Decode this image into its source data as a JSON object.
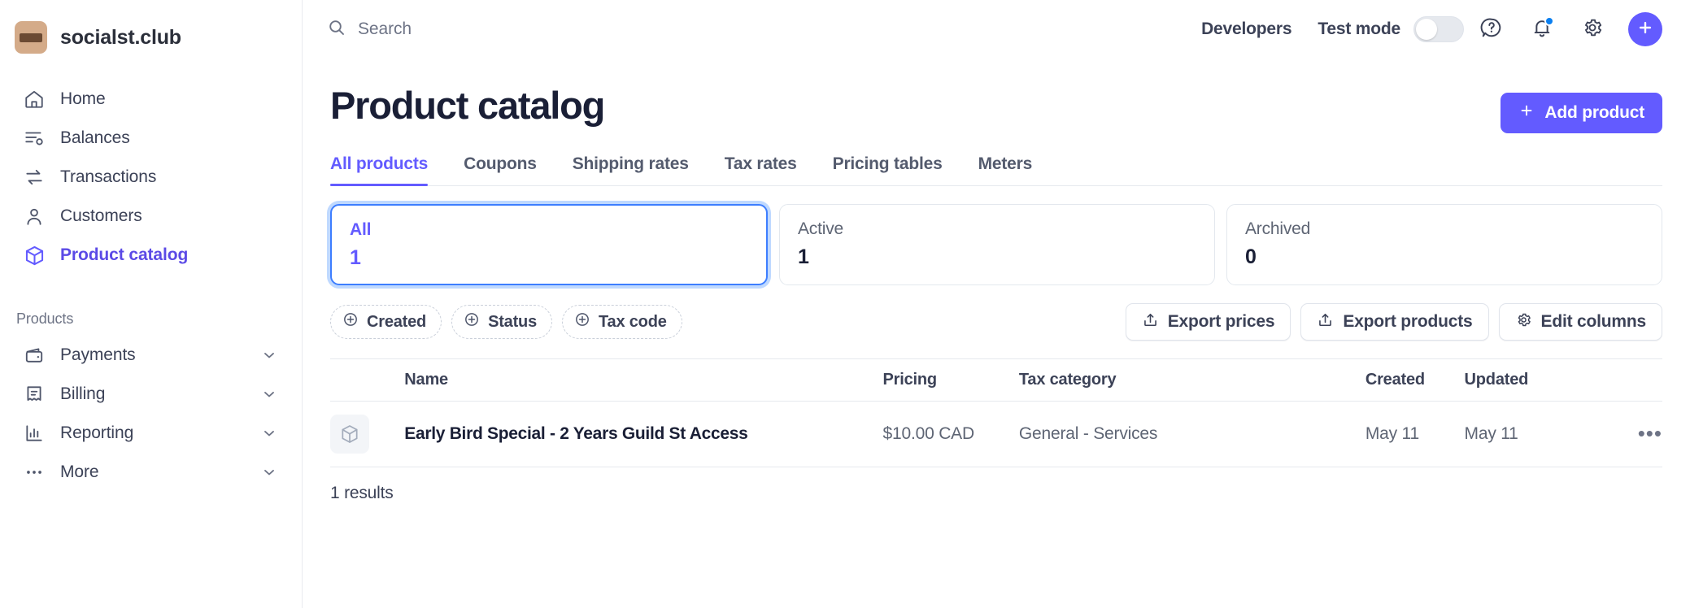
{
  "brand": {
    "name": "socialst.club",
    "avatar_color": "#d4ab89",
    "avatar_bar_color": "#6b4a33"
  },
  "sidebar": {
    "primary_items": [
      {
        "label": "Home",
        "icon": "home-icon",
        "active": false
      },
      {
        "label": "Balances",
        "icon": "balances-icon",
        "active": false
      },
      {
        "label": "Transactions",
        "icon": "transactions-icon",
        "active": false
      },
      {
        "label": "Customers",
        "icon": "customers-icon",
        "active": false
      },
      {
        "label": "Product catalog",
        "icon": "product-catalog-icon",
        "active": true
      }
    ],
    "section_title": "Products",
    "secondary_items": [
      {
        "label": "Payments",
        "icon": "wallet-icon"
      },
      {
        "label": "Billing",
        "icon": "billing-icon"
      },
      {
        "label": "Reporting",
        "icon": "reporting-icon"
      },
      {
        "label": "More",
        "icon": "more-icon"
      }
    ]
  },
  "topbar": {
    "search_placeholder": "Search",
    "developers_label": "Developers",
    "test_mode_label": "Test mode",
    "test_mode_on": false,
    "icons": [
      "help-icon",
      "notifications-icon",
      "settings-icon",
      "plus-icon"
    ]
  },
  "page": {
    "title": "Product catalog",
    "add_button_label": "Add product"
  },
  "tabs": [
    {
      "label": "All products",
      "active": true
    },
    {
      "label": "Coupons",
      "active": false
    },
    {
      "label": "Shipping rates",
      "active": false
    },
    {
      "label": "Tax rates",
      "active": false
    },
    {
      "label": "Pricing tables",
      "active": false
    },
    {
      "label": "Meters",
      "active": false
    }
  ],
  "stat_cards": [
    {
      "label": "All",
      "value": "1",
      "selected": true
    },
    {
      "label": "Active",
      "value": "1",
      "selected": false
    },
    {
      "label": "Archived",
      "value": "0",
      "selected": false
    }
  ],
  "filters": [
    {
      "label": "Created"
    },
    {
      "label": "Status"
    },
    {
      "label": "Tax code"
    }
  ],
  "actions": [
    {
      "label": "Export prices",
      "icon": "export-icon"
    },
    {
      "label": "Export products",
      "icon": "export-icon"
    },
    {
      "label": "Edit columns",
      "icon": "gear-icon"
    }
  ],
  "table": {
    "columns": [
      "",
      "Name",
      "Pricing",
      "Tax category",
      "Created",
      "Updated",
      ""
    ],
    "rows": [
      {
        "name": "Early Bird Special - 2 Years Guild St Access",
        "pricing": "$10.00 CAD",
        "tax_category": "General - Services",
        "created": "May 11",
        "updated": "May 11",
        "menu": "•••"
      }
    ],
    "results_text": "1 results"
  },
  "colors": {
    "accent": "#635bff",
    "focus_ring": "#bfd9ff",
    "text_primary": "#1a1f36",
    "text_secondary": "#5e6574",
    "border": "#e6e9ee"
  }
}
